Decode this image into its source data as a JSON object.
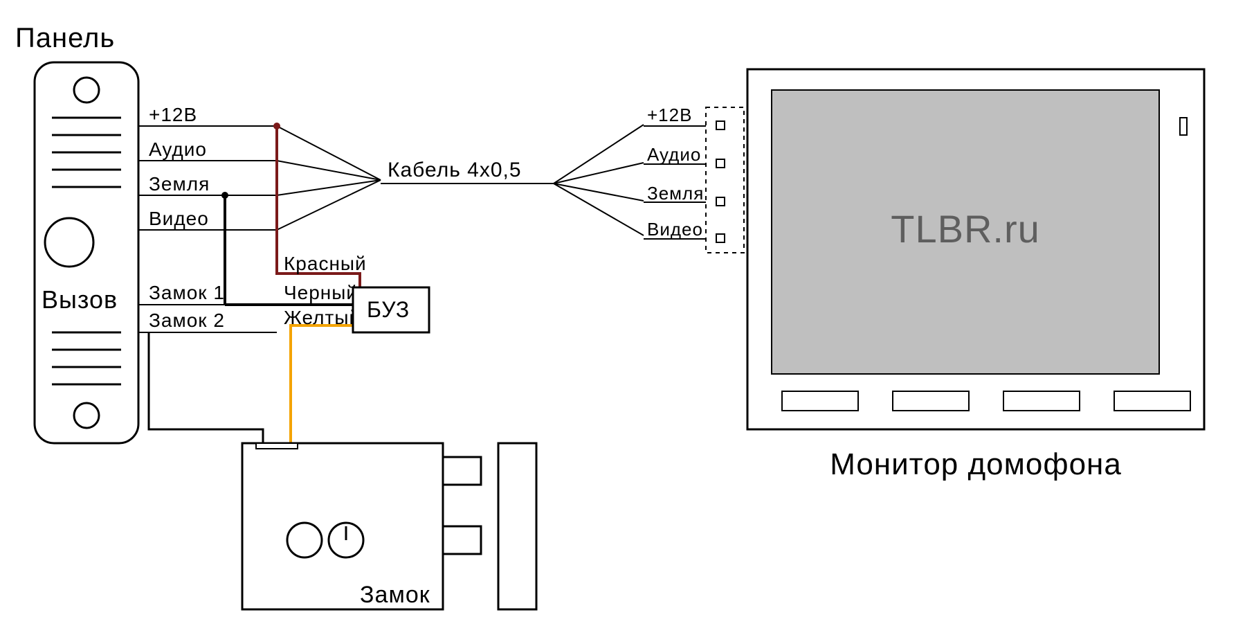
{
  "labels": {
    "panel_title": "Панель",
    "call_button": "Вызов",
    "monitor_title": "Монитор домофона",
    "screen_brand": "TLBR.ru",
    "cable": "Кабель 4х0,5",
    "buz": "БУЗ",
    "lock": "Замок"
  },
  "panel_signals": {
    "v12": "+12В",
    "audio": "Аудио",
    "ground": "Земля",
    "video": "Видео",
    "lock1": "Замок 1",
    "lock2": "Замок 2"
  },
  "monitor_signals": {
    "v12": "+12В",
    "audio": "Аудио",
    "ground": "Земля",
    "video": "Видео"
  },
  "wire_colors_labels": {
    "red": "Красный",
    "black": "Черный",
    "yellow": "Желтый"
  },
  "wire_colors_hex": {
    "red": "#7b1a1a",
    "black": "#000000",
    "yellow": "#f4a300"
  }
}
